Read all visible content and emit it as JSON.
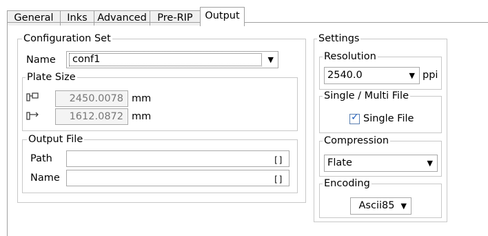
{
  "tabs": [
    {
      "label": "General",
      "active": false
    },
    {
      "label": "Inks",
      "active": false
    },
    {
      "label": "Advanced",
      "active": false
    },
    {
      "label": "Pre-RIP",
      "active": false
    },
    {
      "label": "Output",
      "active": true
    }
  ],
  "config_set": {
    "title": "Configuration Set",
    "name_label": "Name",
    "name_value": "conf1"
  },
  "plate_size": {
    "title": "Plate Size",
    "width_value": "2450.0078",
    "width_unit": "mm",
    "height_value": "1612.0872",
    "height_unit": "mm",
    "width_icon": "plate-width-icon",
    "height_icon": "plate-height-icon"
  },
  "output_file": {
    "title": "Output File",
    "path_label": "Path",
    "path_value": "",
    "name_label": "Name",
    "name_value": "",
    "browse_glyph": "[]"
  },
  "settings": {
    "title": "Settings",
    "resolution": {
      "title": "Resolution",
      "value": "2540.0",
      "unit": "ppi"
    },
    "single_multi": {
      "title": "Single / Multi File",
      "checkbox_label": "Single File",
      "checked": true
    },
    "compression": {
      "title": "Compression",
      "value": "Flate"
    },
    "encoding": {
      "title": "Encoding",
      "value": "Ascii85"
    }
  },
  "colors": {
    "tab_border": "#a0a0a0",
    "group_border": "#c8c8c8",
    "check": "#1f5fbf"
  }
}
